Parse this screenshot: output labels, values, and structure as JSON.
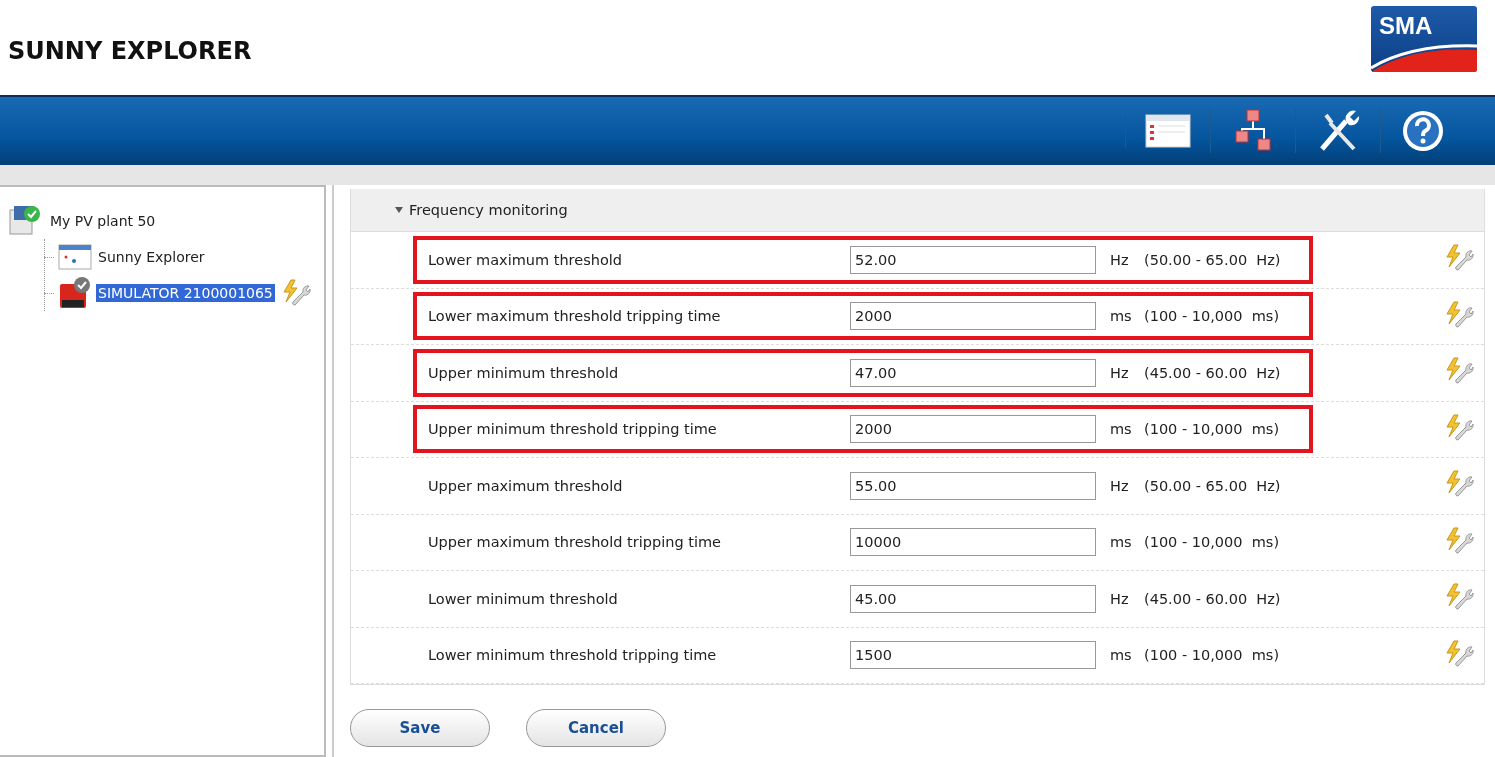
{
  "app": {
    "title": "SUNNY EXPLORER",
    "logo": "SMA"
  },
  "tree": [
    {
      "label": "My PV plant 50",
      "kind": "plant",
      "selected": false,
      "children": [
        {
          "label": "Sunny Explorer",
          "kind": "explorer",
          "selected": false
        },
        {
          "label": "SIMULATOR 2100001065",
          "kind": "inverter",
          "selected": true
        }
      ]
    }
  ],
  "section": {
    "title": "Frequency monitoring",
    "expanded": true,
    "rows": [
      {
        "label": "Lower maximum threshold",
        "value": "52.00",
        "unit": "Hz",
        "range": "(50.00 - 65.00  Hz)",
        "highlighted": true
      },
      {
        "label": "Lower maximum threshold tripping time",
        "value": "2000",
        "unit": "ms",
        "range": "(100 - 10,000  ms)",
        "highlighted": true
      },
      {
        "label": "Upper minimum threshold",
        "value": "47.00",
        "unit": "Hz",
        "range": "(45.00 - 60.00  Hz)",
        "highlighted": true
      },
      {
        "label": "Upper minimum threshold tripping time",
        "value": "2000",
        "unit": "ms",
        "range": "(100 - 10,000  ms)",
        "highlighted": true
      },
      {
        "label": "Upper maximum threshold",
        "value": "55.00",
        "unit": "Hz",
        "range": "(50.00 - 65.00  Hz)",
        "highlighted": false
      },
      {
        "label": "Upper maximum threshold tripping time",
        "value": "10000",
        "unit": "ms",
        "range": "(100 - 10,000  ms)",
        "highlighted": false
      },
      {
        "label": "Lower minimum threshold",
        "value": "45.00",
        "unit": "Hz",
        "range": "(45.00 - 60.00  Hz)",
        "highlighted": false
      },
      {
        "label": "Lower minimum threshold tripping time",
        "value": "1500",
        "unit": "ms",
        "range": "(100 - 10,000  ms)",
        "highlighted": false
      }
    ]
  },
  "buttons": [
    "Save",
    "Cancel"
  ]
}
